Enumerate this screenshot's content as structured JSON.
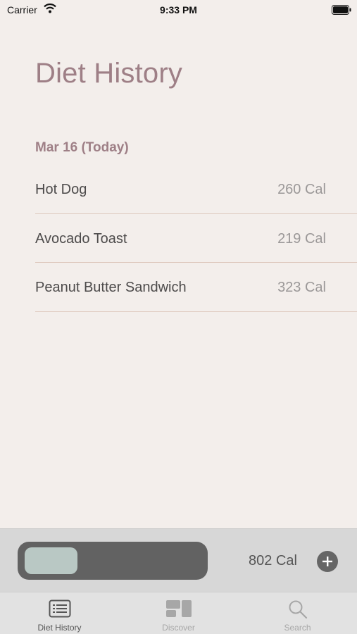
{
  "status_bar": {
    "carrier": "Carrier",
    "time": "9:33 PM"
  },
  "header": {
    "title": "Diet History"
  },
  "section": {
    "date_label": "Mar 16 (Today)"
  },
  "entries": [
    {
      "name": "Hot Dog",
      "calories": "260 Cal"
    },
    {
      "name": "Avocado Toast",
      "calories": "219 Cal"
    },
    {
      "name": "Peanut Butter Sandwich",
      "calories": "323 Cal"
    }
  ],
  "summary": {
    "total": "802 Cal",
    "progress_fraction": 0.3
  },
  "tabs": [
    {
      "label": "Diet History",
      "icon": "list-icon",
      "active": true
    },
    {
      "label": "Discover",
      "icon": "dashboard-icon",
      "active": false
    },
    {
      "label": "Search",
      "icon": "search-icon",
      "active": false
    }
  ],
  "colors": {
    "accent": "#9e7f86",
    "background": "#f3eeeb",
    "divider": "#ddc7bc"
  }
}
